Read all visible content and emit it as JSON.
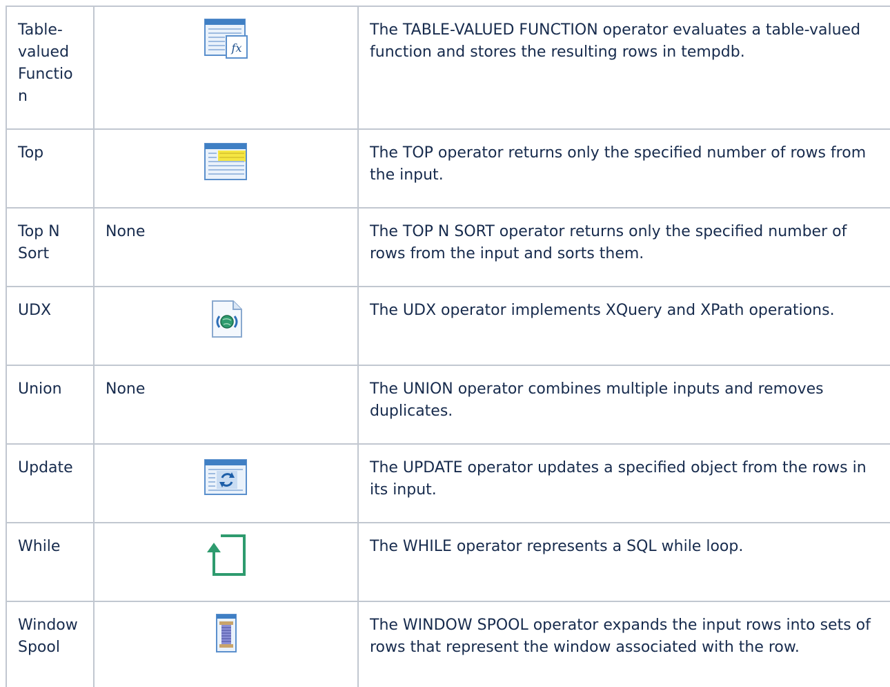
{
  "table": {
    "rows": [
      {
        "name": "Table-valued Function",
        "icon": "table-valued-function-icon",
        "icon_text": "",
        "description": "The TABLE-VALUED FUNCTION operator evaluates a table-valued function and stores the resulting rows in tempdb."
      },
      {
        "name": "Top",
        "icon": "top-icon",
        "icon_text": "",
        "description": "The TOP operator returns only the specified number of rows from the input."
      },
      {
        "name": "Top N Sort",
        "icon": "",
        "icon_text": "None",
        "description": "The TOP N SORT operator returns only the specified number of rows from the input and sorts them."
      },
      {
        "name": "UDX",
        "icon": "udx-icon",
        "icon_text": "",
        "description": "The UDX operator implements XQuery and XPath operations."
      },
      {
        "name": "Union",
        "icon": "",
        "icon_text": "None",
        "description": "The UNION operator combines multiple inputs and removes duplicates."
      },
      {
        "name": "Update",
        "icon": "update-icon",
        "icon_text": "",
        "description": "The UPDATE operator updates a specified object from the rows in its input."
      },
      {
        "name": "While",
        "icon": "while-loop-icon",
        "icon_text": "",
        "description": "The WHILE operator represents a SQL while loop."
      },
      {
        "name": "Window Spool",
        "icon": "window-spool-icon",
        "icon_text": "",
        "description": "The WINDOW SPOOL operator expands the input rows into sets of rows that represent the window associated with the row."
      }
    ]
  },
  "colors": {
    "text": "#172b4d",
    "border": "#c1c7d0",
    "icon_blue": "#3f7fc4",
    "icon_yellow": "#f5e642",
    "icon_green": "#2e9b6e"
  }
}
